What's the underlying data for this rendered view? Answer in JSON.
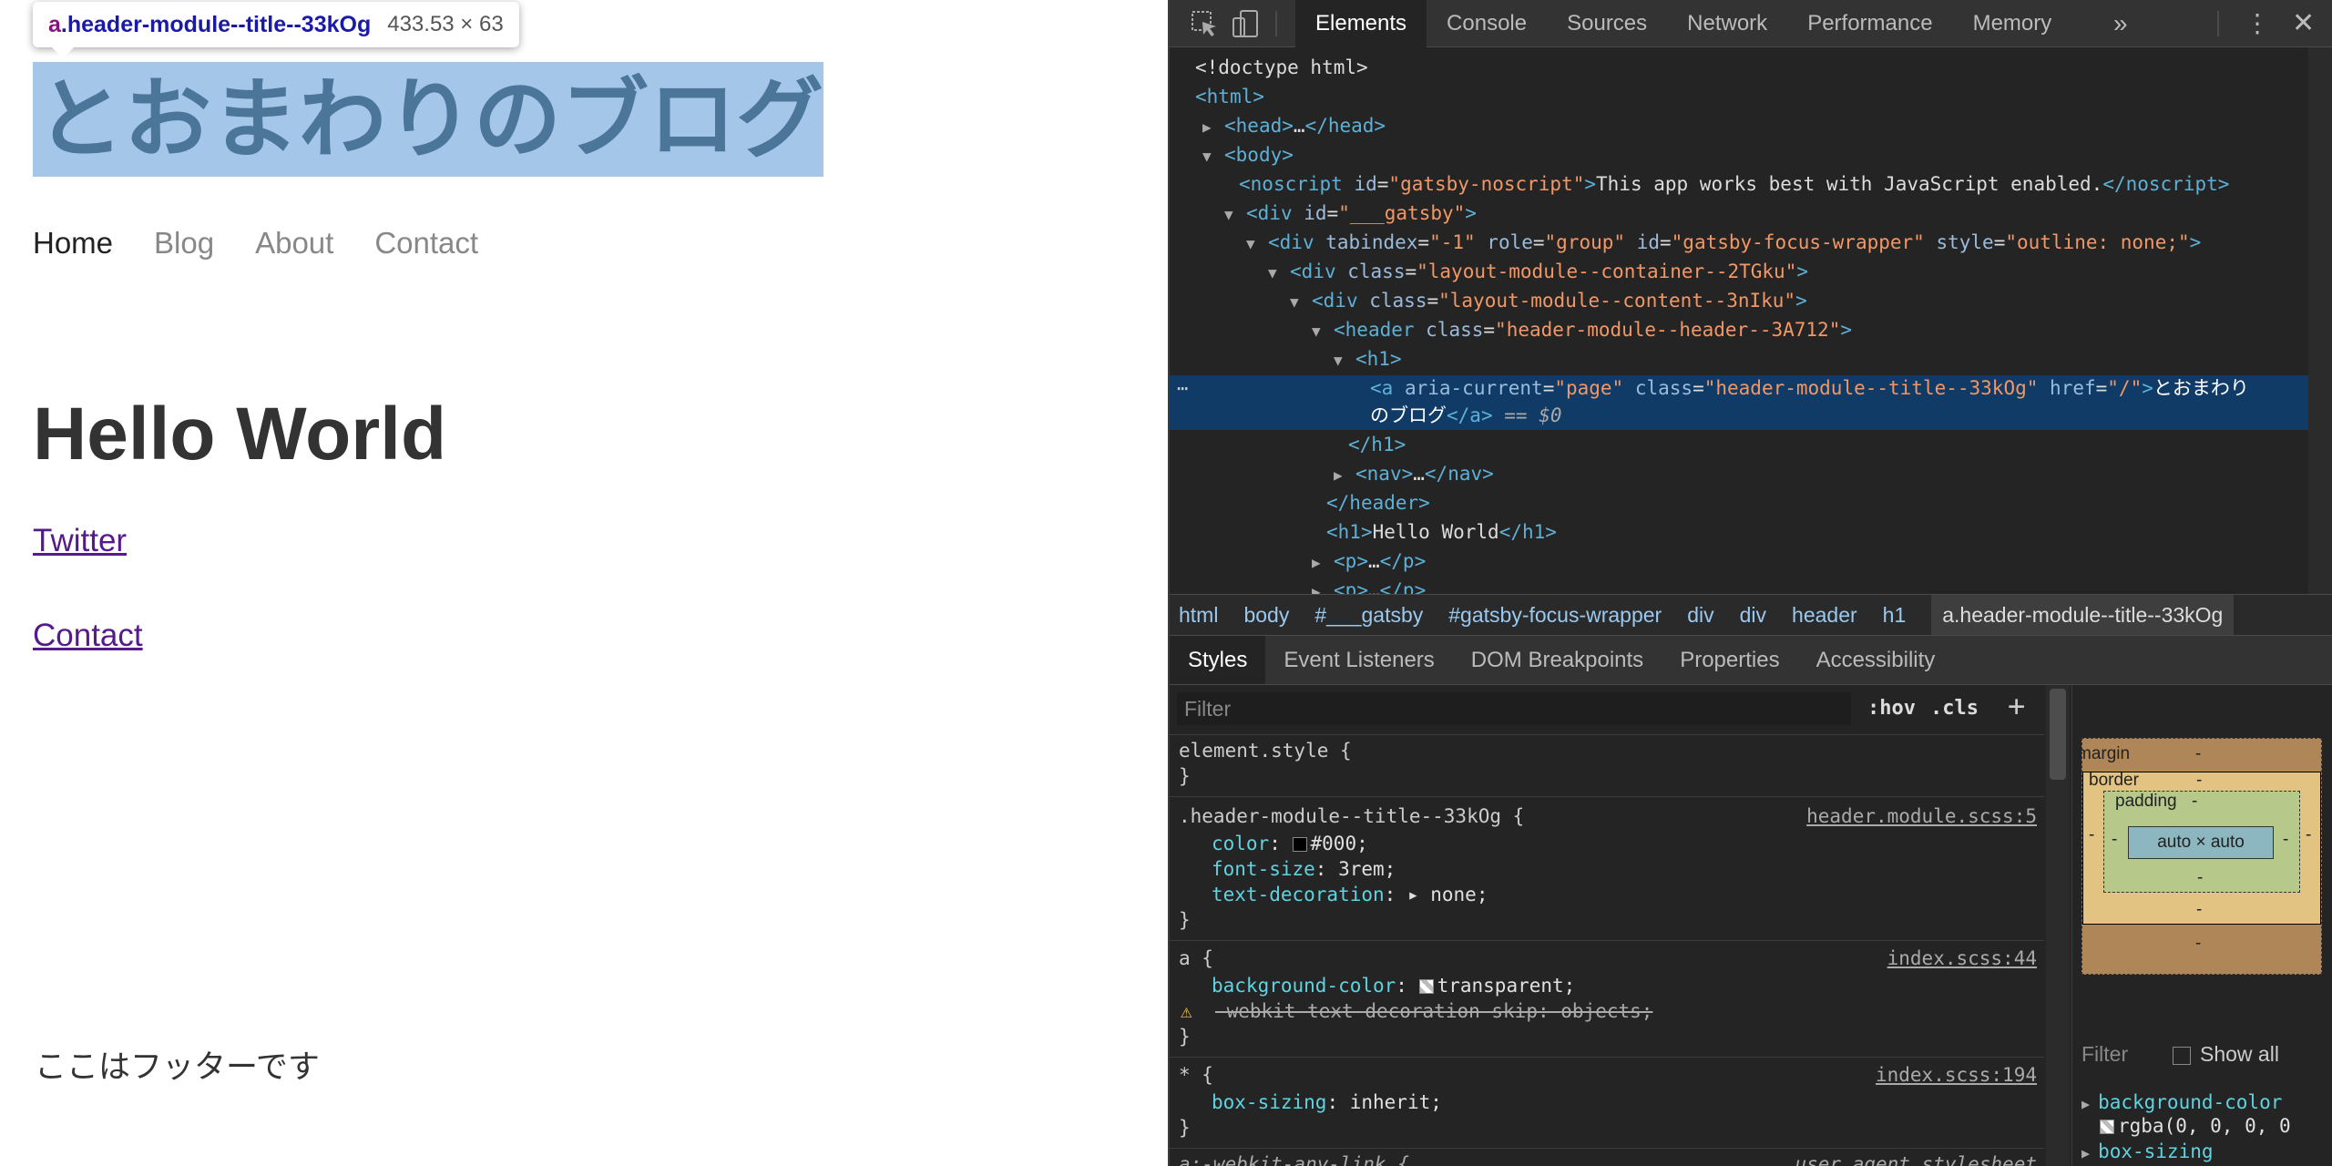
{
  "page": {
    "tooltip": {
      "tag": "a",
      "selector": ".header-module--title--33kOg",
      "size": "433.53 × 63"
    },
    "site_title": "とおまわりのブログ",
    "nav": [
      {
        "label": "Home"
      },
      {
        "label": "Blog"
      },
      {
        "label": "About"
      },
      {
        "label": "Contact"
      }
    ],
    "heading": "Hello World",
    "links": [
      {
        "label": "Twitter"
      },
      {
        "label": "Contact"
      }
    ],
    "footer": "ここはフッターです"
  },
  "devtools": {
    "tabs": [
      "Elements",
      "Console",
      "Sources",
      "Network",
      "Performance",
      "Memory"
    ],
    "more": "»",
    "dom": {
      "doctype": "<!doctype html>",
      "html": "html",
      "head": "head",
      "head_ellipsis": "…",
      "body": "body",
      "noscript": {
        "tag": "noscript",
        "attr": "id",
        "val": "\"gatsby-noscript\"",
        "text": "This app works best with JavaScript enabled."
      },
      "div_gatsby": {
        "tag": "div",
        "attr": "id",
        "val": "\"___gatsby\""
      },
      "focus_wrapper": {
        "tag": "div",
        "a1": "tabindex",
        "v1": "\"-1\"",
        "a2": "role",
        "v2": "\"group\"",
        "a3": "id",
        "v3": "\"gatsby-focus-wrapper\"",
        "a4": "style",
        "v4": "\"outline: none;\""
      },
      "container": {
        "tag": "div",
        "attr": "class",
        "val": "\"layout-module--container--2TGku\""
      },
      "content": {
        "tag": "div",
        "attr": "class",
        "val": "\"layout-module--content--3nIku\""
      },
      "header": {
        "tag": "header",
        "attr": "class",
        "val": "\"header-module--header--3A712\""
      },
      "h1": "h1",
      "a_sel": {
        "tag": "a",
        "a1": "aria-current",
        "v1": "\"page\"",
        "a2": "class",
        "v2": "\"header-module--title--33kOg\"",
        "a3": "href",
        "v3": "\"/\"",
        "text1": "とおまわり",
        "text2": "のブログ",
        "suffix": "== $0"
      },
      "h1_close": "/h1",
      "nav": "nav",
      "nav_ellipsis": "…",
      "header_close": "/header",
      "h1_hello": {
        "tag": "h1",
        "text": "Hello World"
      },
      "p1": "p",
      "p_ellipsis": "…",
      "p2": "p",
      "p2_ellipsis": "…"
    },
    "breadcrumbs": [
      "html",
      "body",
      "#___gatsby",
      "#gatsby-focus-wrapper",
      "div",
      "div",
      "header",
      "h1",
      "a.header-module--title--33kOg"
    ],
    "subtabs": [
      "Styles",
      "Event Listeners",
      "DOM Breakpoints",
      "Properties",
      "Accessibility"
    ],
    "styles": {
      "filter_placeholder": "Filter",
      "hov": ":hov",
      "cls": ".cls",
      "plus": "+",
      "element_style": "element.style {",
      "rule1_selector": ".header-module--title--33kOg {",
      "rule1_source": "header.module.scss:5",
      "rule1_props": [
        {
          "name": "color",
          "value": "#000;",
          "swatch": "#000000"
        },
        {
          "name": "font-size",
          "value": "3rem;"
        },
        {
          "name": "text-decoration",
          "value": "none;"
        }
      ],
      "rule2_selector": "a {",
      "rule2_source": "index.scss:44",
      "rule2_props": [
        {
          "name": "background-color",
          "value": "transparent;"
        },
        {
          "name": "-webkit-text-decoration-skip",
          "value": "objects;"
        }
      ],
      "rule3_selector": "* {",
      "rule3_source": "index.scss:194",
      "rule3_props": [
        {
          "name": "box-sizing",
          "value": "inherit;"
        }
      ],
      "rule4_selector": "a:-webkit-any-link {",
      "rule4_source": "user agent stylesheet",
      "close_brace": "}"
    },
    "boxmodel": {
      "margin": "margin",
      "border": "border",
      "padding": "padding",
      "content": "auto × auto",
      "dash": "-"
    },
    "computed": {
      "filter_placeholder": "Filter",
      "show_all": "Show all",
      "props": [
        {
          "name": "background-color",
          "value": "rgba(0, 0, 0, 0"
        },
        {
          "name": "box-sizing",
          "value": ""
        }
      ]
    }
  }
}
